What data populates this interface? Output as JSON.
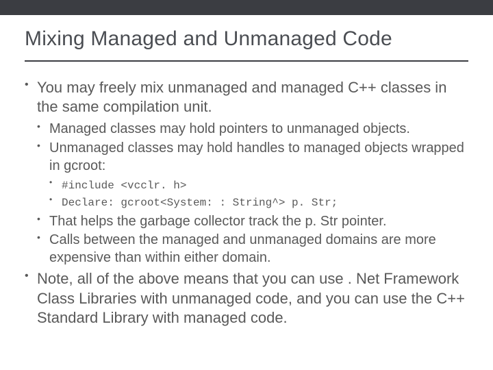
{
  "slide": {
    "title": "Mixing Managed and Unmanaged Code",
    "bullets": [
      {
        "text": "You may freely mix unmanaged and managed C++ classes in the same compilation unit.",
        "children": [
          {
            "text": "Managed classes may hold pointers to unmanaged objects."
          },
          {
            "text": "Unmanaged classes may hold handles to managed objects wrapped in gcroot:",
            "children": [
              {
                "text": "#include <vcclr. h>",
                "code": true
              },
              {
                "text": "Declare: gcroot<System: : String^> p. Str;",
                "code": true
              }
            ]
          },
          {
            "text": "That helps the garbage collector track the p. Str pointer."
          },
          {
            "text": "Calls between the managed and unmanaged domains are more expensive than within either domain."
          }
        ]
      },
      {
        "text": "Note, all of the above means that you can use . Net Framework Class Libraries with unmanaged code, and you can use the C++ Standard Library with managed code."
      }
    ]
  }
}
